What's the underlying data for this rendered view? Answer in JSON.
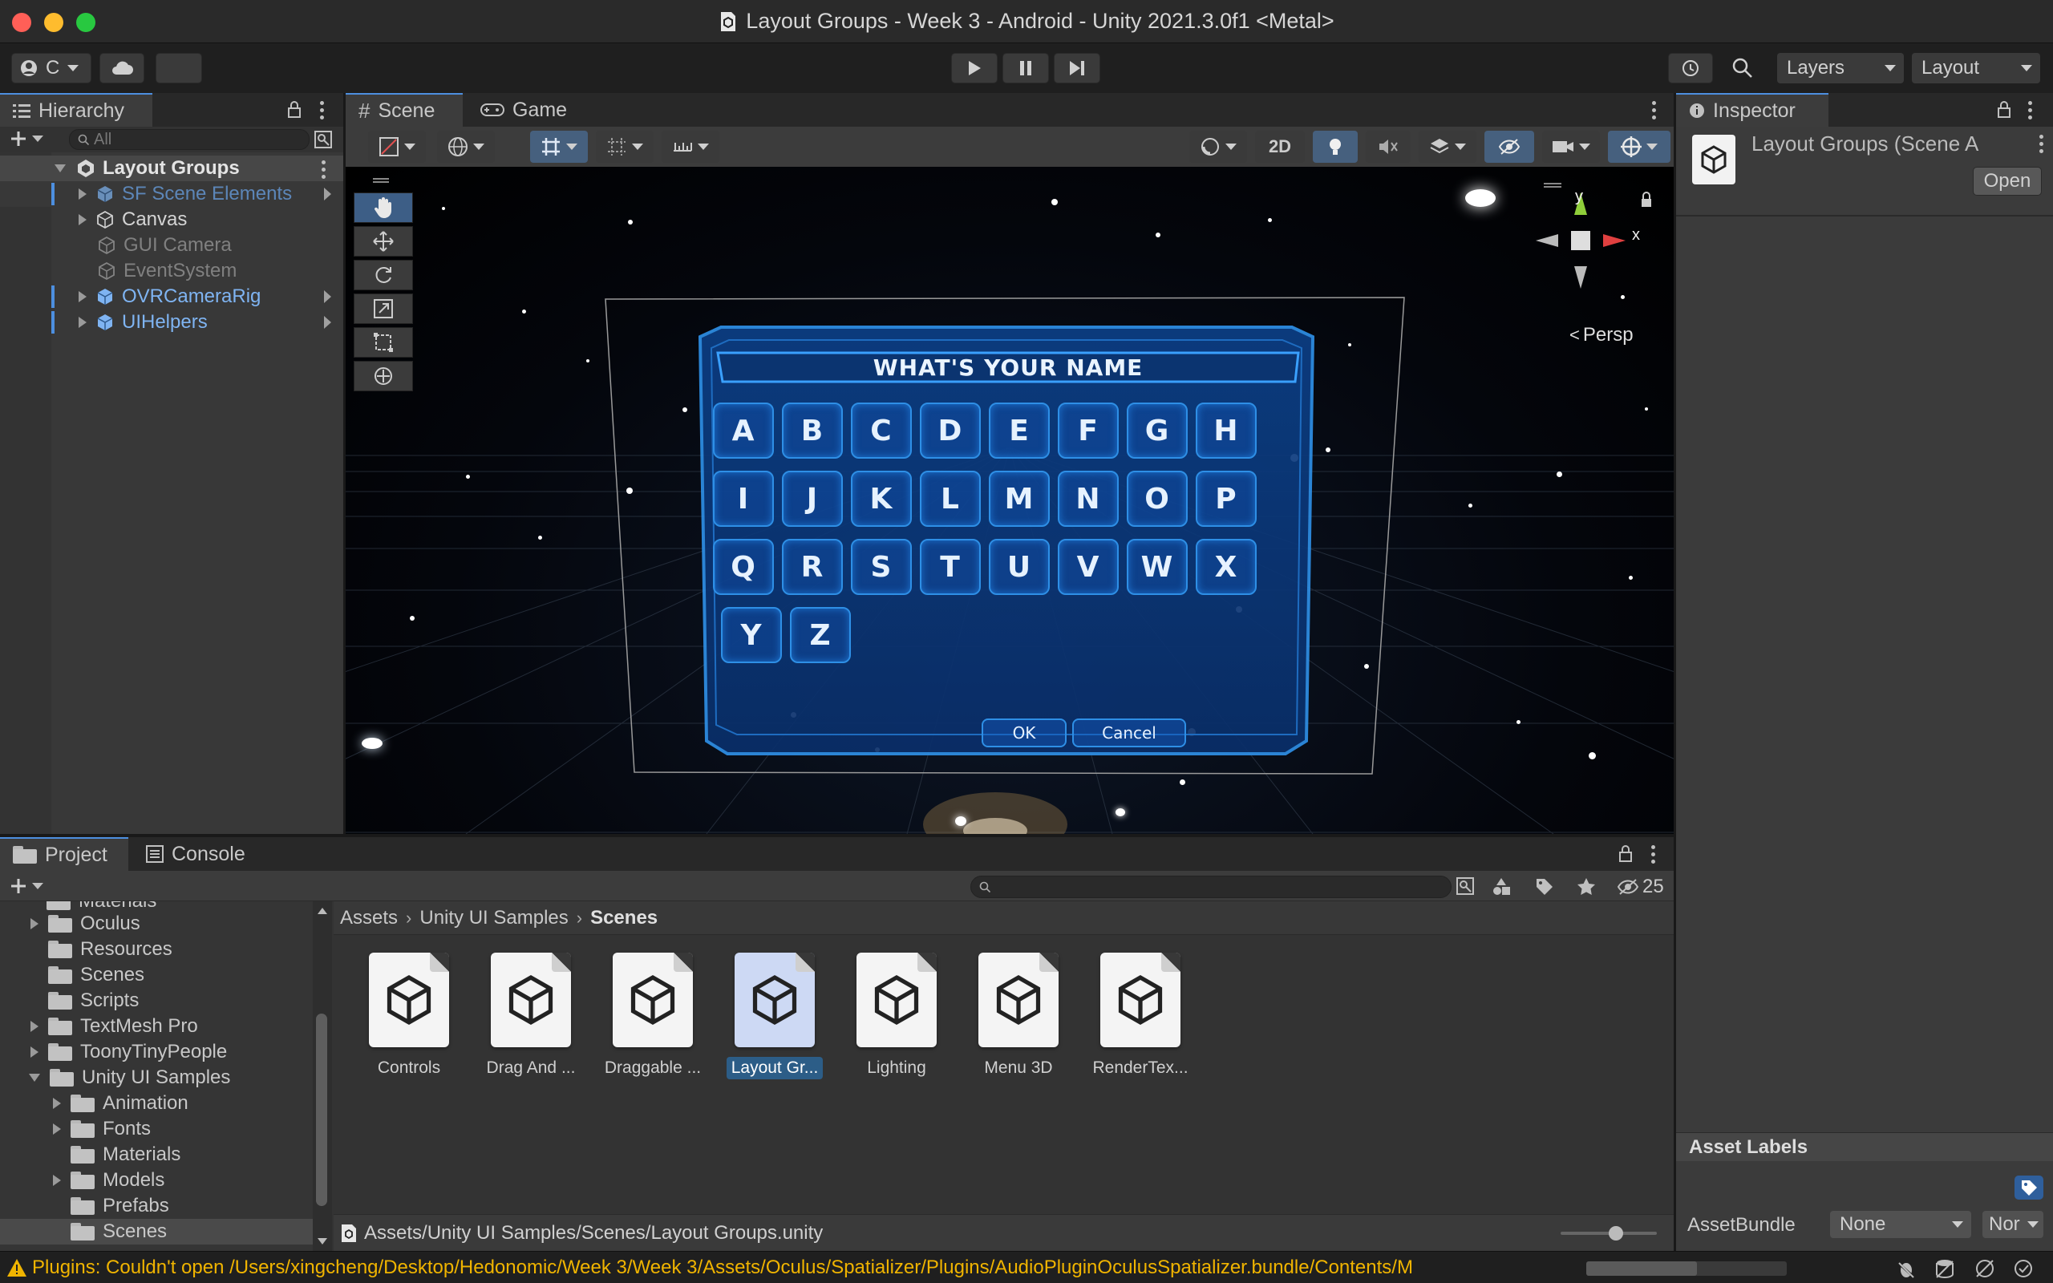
{
  "window": {
    "title": "Layout Groups - Week 3 - Android - Unity 2021.3.0f1 <Metal>"
  },
  "toolbar": {
    "account_label": "C",
    "layers_label": "Layers",
    "layout_label": "Layout"
  },
  "hierarchy": {
    "tab_label": "Hierarchy",
    "search_placeholder": "All",
    "scene_name": "Layout Groups",
    "items": [
      {
        "label": "SF Scene Elements"
      },
      {
        "label": "Canvas"
      },
      {
        "label": "GUI Camera"
      },
      {
        "label": "EventSystem"
      },
      {
        "label": "OVRCameraRig"
      },
      {
        "label": "UIHelpers"
      }
    ]
  },
  "scene_view": {
    "tabs": [
      {
        "label": "Scene"
      },
      {
        "label": "Game"
      }
    ],
    "mode_2d_label": "2D",
    "gizmo": {
      "y": "y",
      "x": "x",
      "persp": "Persp"
    },
    "keyboard": {
      "title": "WHAT'S YOUR NAME",
      "keys": [
        "A",
        "B",
        "C",
        "D",
        "E",
        "F",
        "G",
        "H",
        "I",
        "J",
        "K",
        "L",
        "M",
        "N",
        "O",
        "P",
        "Q",
        "R",
        "S",
        "T",
        "U",
        "V",
        "W",
        "X",
        "Y",
        "Z"
      ],
      "ok_label": "OK",
      "cancel_label": "Cancel"
    }
  },
  "inspector": {
    "tab_label": "Inspector",
    "object_name": "Layout Groups (Scene A",
    "open_label": "Open",
    "asset_labels_title": "Asset Labels",
    "assetbundle_label": "AssetBundle",
    "assetbundle_value": "None",
    "variant_value": "Nor"
  },
  "project": {
    "tabs": [
      {
        "label": "Project"
      },
      {
        "label": "Console"
      }
    ],
    "hidden_count": "25",
    "partial_top_folder": "Materials",
    "folders": [
      {
        "label": "Oculus"
      },
      {
        "label": "Resources"
      },
      {
        "label": "Scenes"
      },
      {
        "label": "Scripts"
      },
      {
        "label": "TextMesh Pro"
      },
      {
        "label": "ToonyTinyPeople"
      },
      {
        "label": "Unity UI Samples"
      },
      {
        "label": "Animation"
      },
      {
        "label": "Fonts"
      },
      {
        "label": "Materials"
      },
      {
        "label": "Models"
      },
      {
        "label": "Prefabs"
      },
      {
        "label": "Scenes"
      }
    ],
    "breadcrumb": [
      "Assets",
      "Unity UI Samples",
      "Scenes"
    ],
    "assets": [
      {
        "label": "Controls"
      },
      {
        "label": "Drag And ..."
      },
      {
        "label": "Draggable ..."
      },
      {
        "label": "Layout Gr..."
      },
      {
        "label": "Lighting"
      },
      {
        "label": "Menu 3D"
      },
      {
        "label": "RenderTex..."
      }
    ],
    "selected_path": "Assets/Unity UI Samples/Scenes/Layout Groups.unity"
  },
  "status": {
    "message": "Plugins: Couldn't open /Users/xingcheng/Desktop/Hedonomic/Week 3/Week 3/Assets/Oculus/Spatializer/Plugins/AudioPluginOculusSpatializer.bundle/Contents/M"
  },
  "colors": {
    "accent": "#4d8fe0",
    "warning": "#f0b400",
    "prefab_blue": "#7fb4f2",
    "selection": "#2c5d87"
  }
}
